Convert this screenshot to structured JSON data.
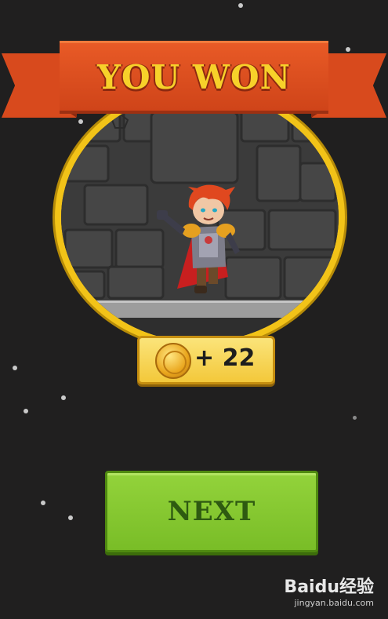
{
  "banner": {
    "title": "YOU WON"
  },
  "reward": {
    "amount": "+ 22",
    "icon": "coin-icon"
  },
  "button": {
    "next_label": "NEXT"
  },
  "watermark": {
    "logo": "Baidu经验",
    "url": "jingyan.baidu.com"
  },
  "colors": {
    "background": "#201f1f",
    "ribbon": "#d84a1d",
    "title_gold": "#f7d12a",
    "ring": "#f2c318",
    "button_green": "#86c832"
  }
}
